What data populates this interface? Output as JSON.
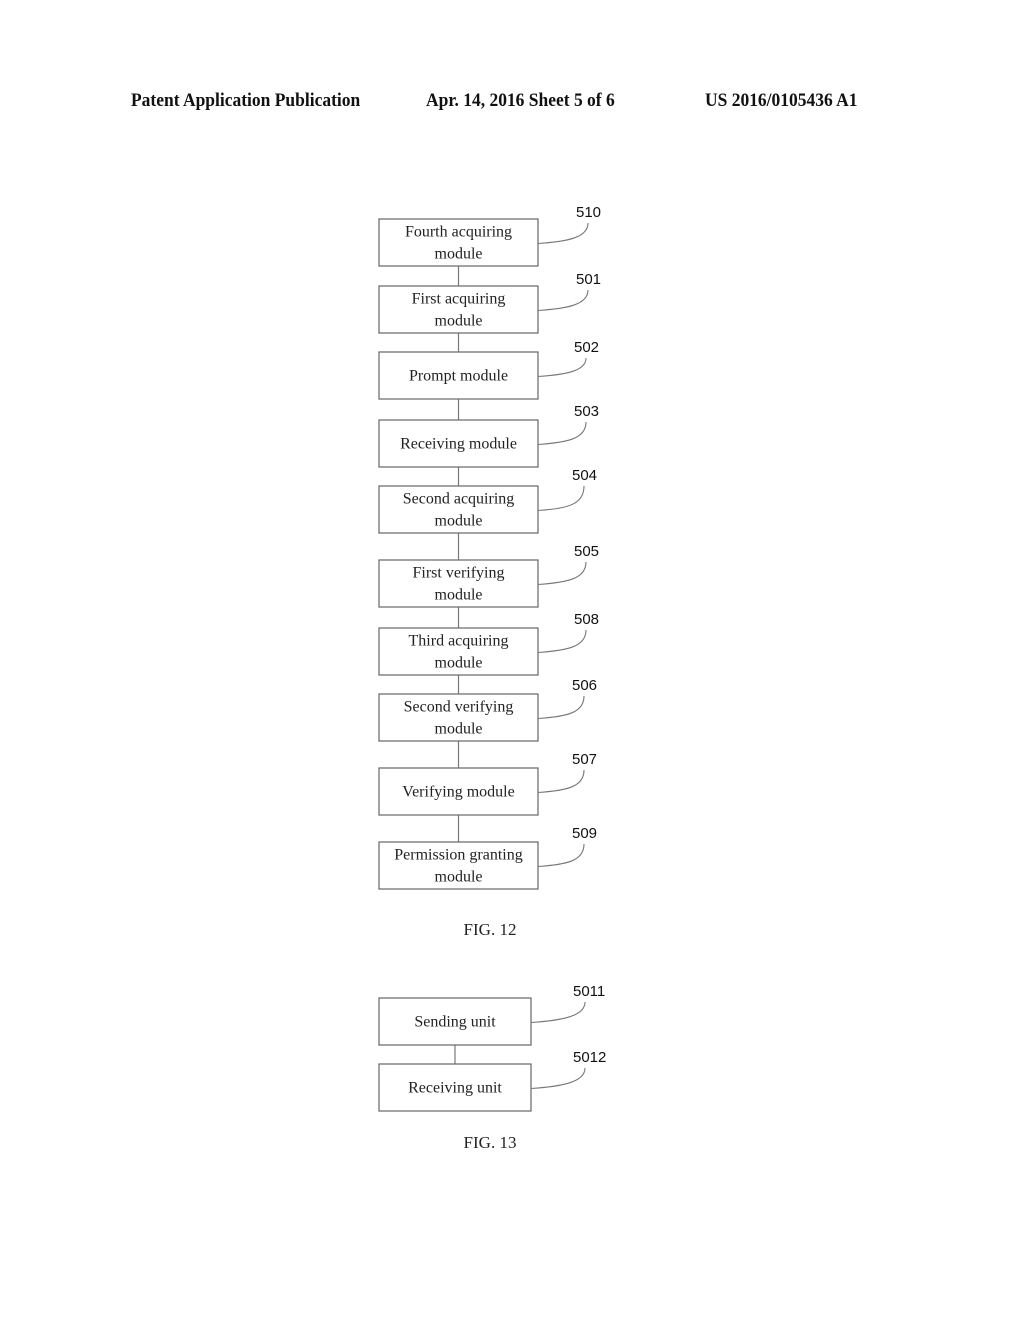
{
  "header": {
    "left": "Patent Application Publication",
    "center": "Apr. 14, 2016  Sheet 5 of 6",
    "right": "US 2016/0105436 A1"
  },
  "figures": [
    {
      "caption": "FIG. 12",
      "modules": [
        {
          "ref": "510",
          "lines": [
            "Fourth acquiring",
            "module"
          ]
        },
        {
          "ref": "501",
          "lines": [
            "First acquiring",
            "module"
          ]
        },
        {
          "ref": "502",
          "lines": [
            "Prompt module"
          ]
        },
        {
          "ref": "503",
          "lines": [
            "Receiving module"
          ]
        },
        {
          "ref": "504",
          "lines": [
            "Second acquiring",
            "module"
          ]
        },
        {
          "ref": "505",
          "lines": [
            "First verifying",
            "module"
          ]
        },
        {
          "ref": "508",
          "lines": [
            "Third acquiring",
            "module"
          ]
        },
        {
          "ref": "506",
          "lines": [
            "Second verifying",
            "module"
          ]
        },
        {
          "ref": "507",
          "lines": [
            "Verifying module"
          ]
        },
        {
          "ref": "509",
          "lines": [
            "Permission granting",
            "module"
          ]
        }
      ]
    },
    {
      "caption": "FIG. 13",
      "modules": [
        {
          "ref": "5011",
          "lines": [
            "Sending unit"
          ]
        },
        {
          "ref": "5012",
          "lines": [
            "Receiving unit"
          ]
        }
      ]
    }
  ]
}
